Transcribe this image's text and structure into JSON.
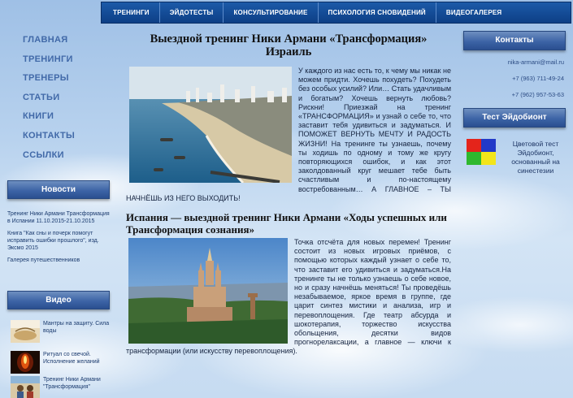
{
  "topnav": {
    "items": [
      "ТРЕНИНГИ",
      "ЭЙДОТЕСТЫ",
      "КОНСУЛЬТИРОВАНИЕ",
      "ПСИХОЛОГИЯ СНОВИДЕНИЙ",
      "ВИДЕОГАЛЕРЕЯ"
    ]
  },
  "sidebar": {
    "menu": [
      "ГЛАВНАЯ",
      "ТРЕНИНГИ",
      "ТРЕНЕРЫ",
      "СТАТЬИ",
      "КНИГИ",
      "КОНТАКТЫ",
      "ССЫЛКИ"
    ],
    "news_title": "Новости",
    "news": [
      "Тренинг Ники Армани Трансформация в Испании 11.10.2015-21.10.2015",
      "Книга \"Как сны и почерк помогут исправить ошибки прошлого\", изд. Эксмо 2015",
      "Галерея путешественников"
    ],
    "video_title": "Видео",
    "videos": [
      {
        "title": "Мантры на защиту. Сила воды"
      },
      {
        "title": "Ритуал со свечой. Исполнение желаний"
      },
      {
        "title": "Тренинг Ники Армани \"Трансформация\""
      }
    ]
  },
  "contacts": {
    "title": "Контакты",
    "email": "nika-armani@mail.ru",
    "phone1": "+7 (963) 711-49-24",
    "phone2": "+7 (962) 957-53-63"
  },
  "test": {
    "title": "Тест Эйдобионт",
    "text": "Цветовой тест Эйдобионт, основанный на синестезии",
    "colors": [
      "#e4241b",
      "#2239c8",
      "#2fb82e",
      "#f3e51b"
    ]
  },
  "main": {
    "title1": "Выездной тренинг Ники Армани «Трансформация» Израиль",
    "para1": "У каждого из нас есть то, к чему мы никак не можем придти. Хочешь похудеть? Похудеть без особых усилий? Или… Стать удачливым и богатым? Хочешь вернуть любовь? Рискни! Приезжай на тренинг «ТРАНСФОРМАЦИЯ» и узнай о себе то, что заставит тебя удивиться и задуматься. И ПОМОЖЕТ ВЕРНУТЬ МЕЧТУ И РАДОСТЬ ЖИЗНИ! На тренинге ты узнаешь, почему ты ходишь по одному и тому же кругу повторяющихся ошибок, и как этот заколдованный круг мешает тебе быть счастливым и по-настоящему востребованным… А ГЛАВНОЕ – ТЫ НАЧНЁШЬ ИЗ НЕГО ВЫХОДИТЬ!",
    "title2": "Испания — выездной тренинг Ники Армани «Ходы успешных или Трансформация сознания»",
    "para2": "Точка отсчёта для новых перемен! Тренинг состоит из новых игровых приёмов, с помощью которых каждый узнает о себе то, что заставит его удивиться и задуматься.На тренинге ты не только узнаешь о себе новое, но и сразу начнёшь меняться! Ты проведёшь незабываемое, яркое время в группе, где царит синтез мистики и анализа, игр и перевоплощения. Где театр абсурда и шокотерапия, торжество искусства обольщения, десятки видов прогнорелаксации, а главное — ключи к трансформации (или искусству перевоплощения)."
  }
}
